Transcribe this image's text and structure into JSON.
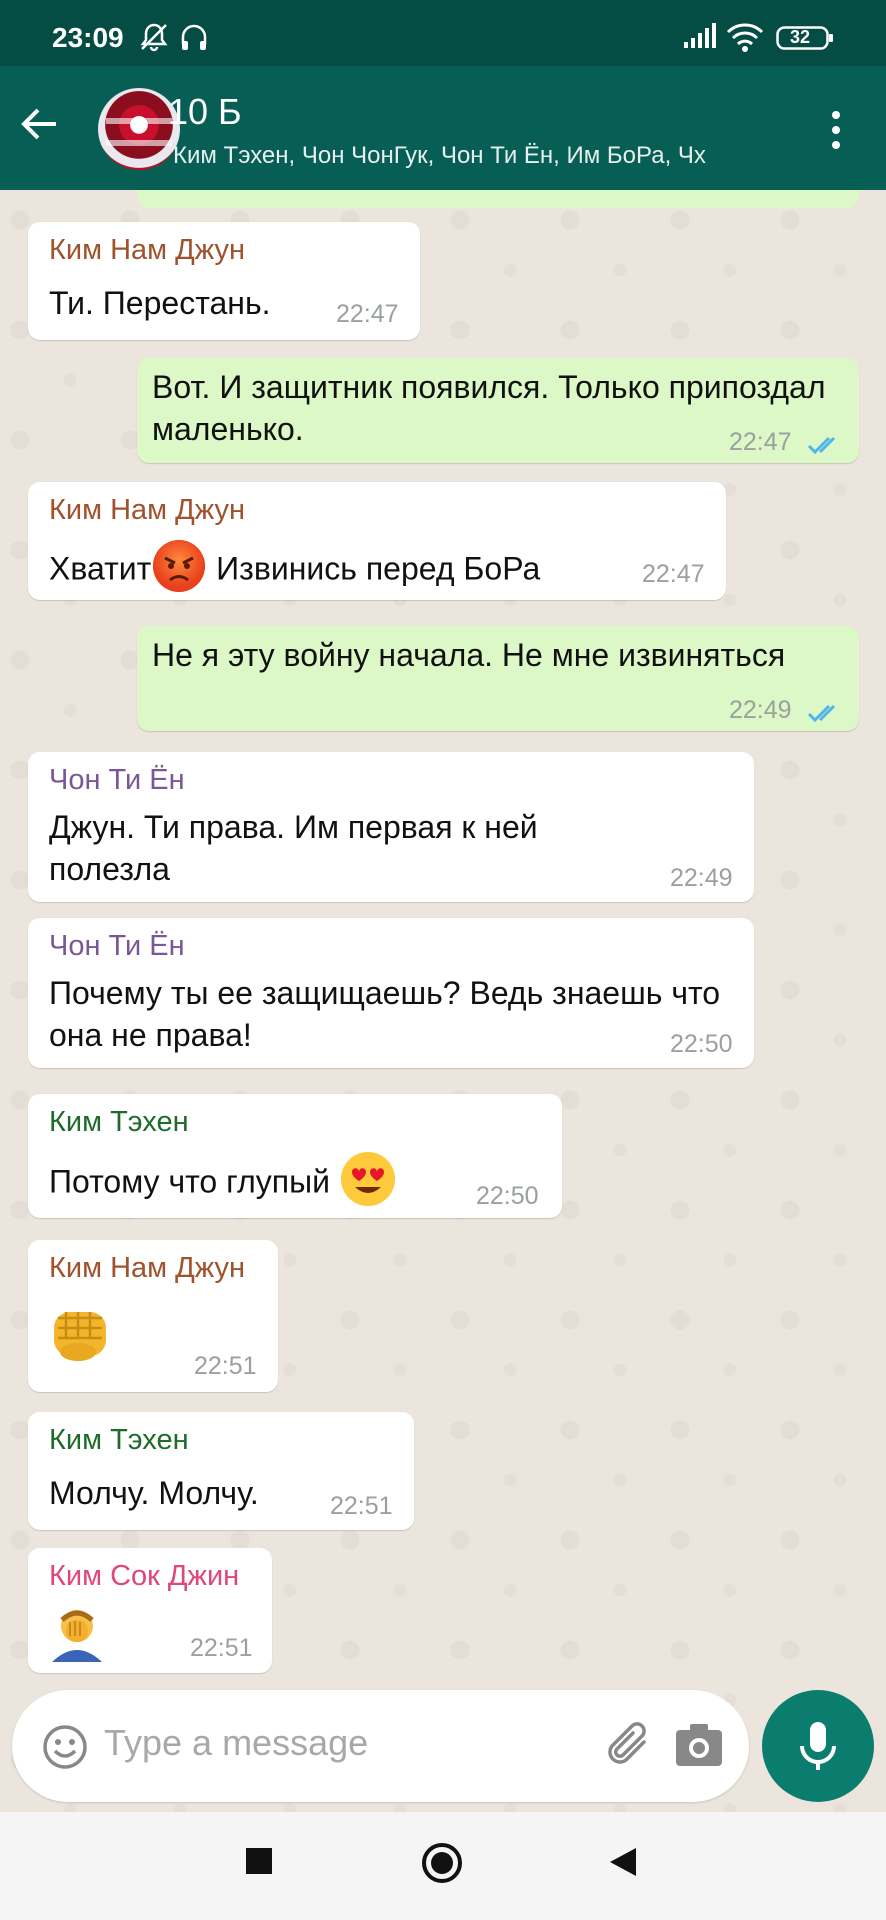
{
  "status_bar": {
    "time": "23:09",
    "battery": "32"
  },
  "header": {
    "title": "10 Б",
    "subtitle": "Ким Тэхен, Чон ЧонГук, Чон Ти Ён, Им БоРа, Чх"
  },
  "colors": {
    "header": "#075e54",
    "status_bar": "#054d44",
    "outgoing_bubble": "#dcf8c6",
    "incoming_bubble": "#ffffff",
    "read_ticks": "#4fb6ec",
    "sender_kim_nam_jun": "#a0522d",
    "sender_chon_ti_yon": "#7a5896",
    "sender_kim_tehen": "#1e6b2c",
    "sender_kim_sok_jin": "#e0457b"
  },
  "messages": [
    {
      "sender": "Ким Нам Джун",
      "text": "Ти. Перестань.",
      "time": "22:47"
    },
    {
      "text": "Вот. И защитник появился. Только припоздал маленько.",
      "time": "22:47",
      "status": "read"
    },
    {
      "sender": "Ким Нам Джун",
      "text_before": "Хватит",
      "emoji": "angry-face-icon",
      "text_after": " Извинись перед БоРа",
      "time": "22:47"
    },
    {
      "text": "Не я эту войну начала. Не мне извиняться",
      "time": "22:49",
      "status": "read"
    },
    {
      "sender": "Чон Ти Ён",
      "text": "Джун. Ти права. Им первая к ней полезла",
      "time": "22:49"
    },
    {
      "sender": "Чон Ти Ён",
      "text": "Почему ты ее защищаешь? Ведь знаешь что она не права!",
      "time": "22:50"
    },
    {
      "sender": "Ким Тэхен",
      "text": "Потому что глупый ",
      "emoji": "heart-eyes-face-icon",
      "time": "22:50"
    },
    {
      "sender": "Ким Нам Джун",
      "emoji": "oncoming-fist-icon",
      "time": "22:51"
    },
    {
      "sender": "Ким Тэхен",
      "text": "Молчу. Молчу.",
      "time": "22:51"
    },
    {
      "sender": "Ким Сок Джин",
      "emoji": "man-facepalming-icon",
      "time": "22:51"
    }
  ],
  "composer": {
    "placeholder": "Type a message"
  }
}
